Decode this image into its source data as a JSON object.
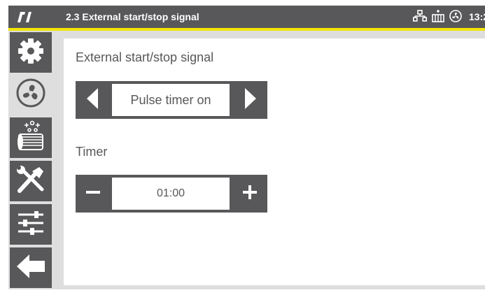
{
  "header": {
    "title": "2.3 External start/stop signal",
    "clock": "13:2",
    "icons": [
      "logo-icon",
      "network-icon",
      "heater-icon",
      "fan-status-icon"
    ]
  },
  "colors": {
    "bar": "#58585a",
    "accent": "#f2e500",
    "frame": "#dedede",
    "content": "#ffffff"
  },
  "sidebar": {
    "items": [
      {
        "icon": "gear-icon",
        "selected": false
      },
      {
        "icon": "fan-icon",
        "selected": true
      },
      {
        "icon": "filter-icon",
        "selected": false
      },
      {
        "icon": "tools-icon",
        "selected": false
      },
      {
        "icon": "sliders-icon",
        "selected": false
      },
      {
        "icon": "back-arrow-icon",
        "selected": false
      }
    ]
  },
  "main": {
    "signal_label": "External start/stop signal",
    "signal_value": "Pulse timer on",
    "timer_label": "Timer",
    "timer_value": "01:00"
  }
}
